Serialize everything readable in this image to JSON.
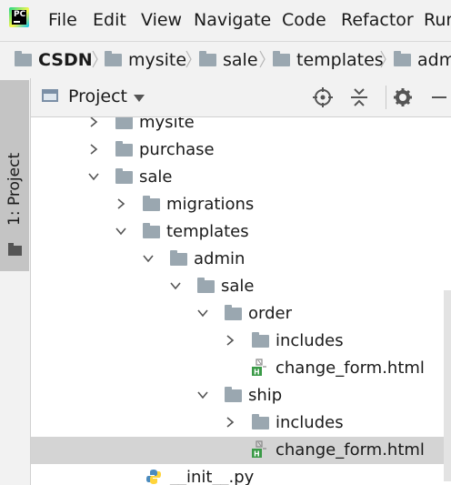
{
  "app": {
    "icon_text": "PC"
  },
  "menu": [
    "File",
    "Edit",
    "View",
    "Navigate",
    "Code",
    "Refactor",
    "Run"
  ],
  "breadcrumb": [
    "CSDN",
    "mysite",
    "sale",
    "templates",
    "admin"
  ],
  "toolstrip": {
    "tab_label": "1: Project"
  },
  "panel": {
    "title": "Project"
  },
  "tree": {
    "rows": [
      {
        "label": "mysite",
        "kind": "folder",
        "expanded": false
      },
      {
        "label": "purchase",
        "kind": "folder",
        "expanded": false
      },
      {
        "label": "sale",
        "kind": "folder",
        "expanded": true
      },
      {
        "label": "migrations",
        "kind": "folder",
        "expanded": false
      },
      {
        "label": "templates",
        "kind": "folder",
        "expanded": true
      },
      {
        "label": "admin",
        "kind": "folder",
        "expanded": true
      },
      {
        "label": "sale",
        "kind": "folder",
        "expanded": true
      },
      {
        "label": "order",
        "kind": "folder",
        "expanded": true
      },
      {
        "label": "includes",
        "kind": "folder",
        "expanded": false
      },
      {
        "label": "change_form.html",
        "kind": "html-file"
      },
      {
        "label": "ship",
        "kind": "folder",
        "expanded": true
      },
      {
        "label": "includes",
        "kind": "folder",
        "expanded": false
      },
      {
        "label": "change_form.html",
        "kind": "html-file",
        "selected": true
      },
      {
        "label": "__init__.py",
        "kind": "python-file"
      }
    ]
  },
  "colors": {
    "folder": "#9aa7b0",
    "selection": "#d4d4d4",
    "html_icon": "#3a9a47"
  }
}
